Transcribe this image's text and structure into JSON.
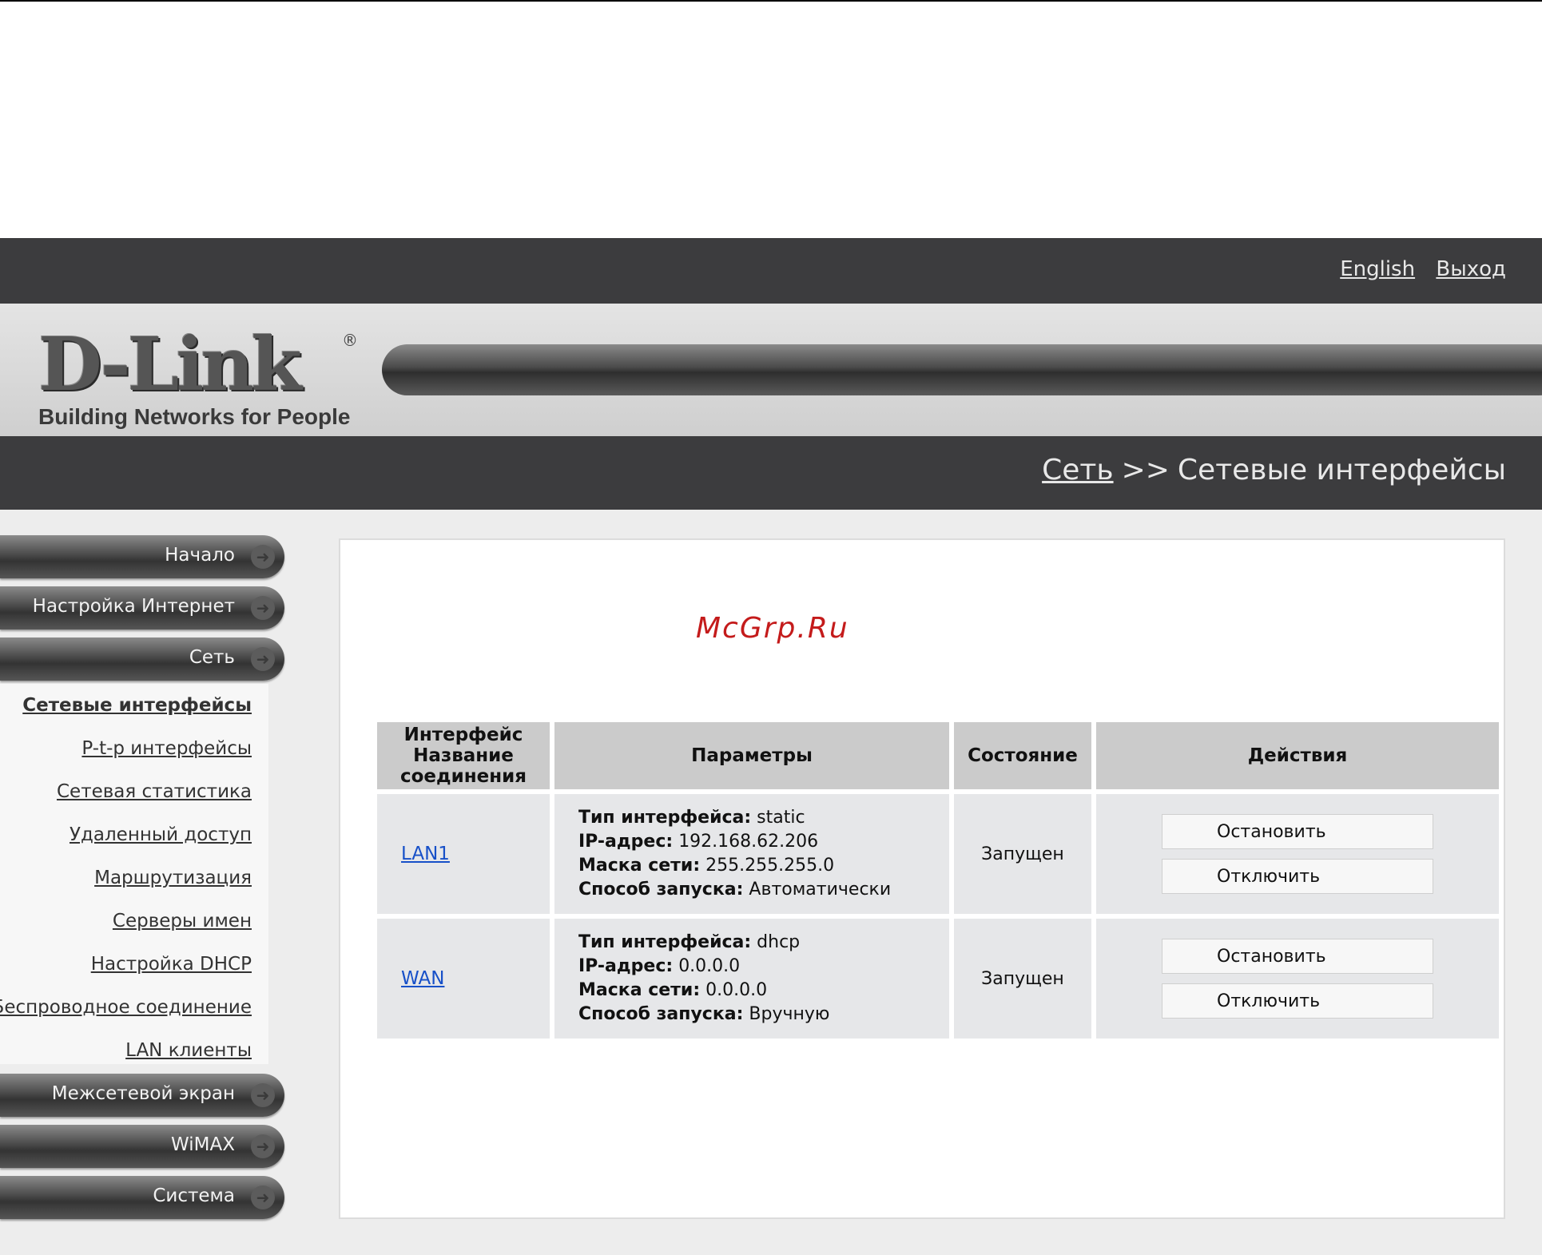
{
  "header": {
    "links": [
      "English",
      "Выход"
    ]
  },
  "logo": {
    "wordmark": "D-Link",
    "registered": "®",
    "tagline": "Building Networks for People"
  },
  "breadcrumb": {
    "parent": "Сеть",
    "separator": ">>",
    "current": "Сетевые интерфейсы"
  },
  "sidebar": {
    "top_items": [
      "Начало",
      "Настройка Интернет",
      "Сеть"
    ],
    "submenu": [
      "Сетевые интерфейсы",
      "P-t-p интерфейсы",
      "Сетевая статистика",
      "Удаленный доступ",
      "Маршрутизация",
      "Серверы имен",
      "Настройка DHCP",
      "Беспроводное соединение",
      "LAN клиенты"
    ],
    "bottom_items": [
      "Межсетевой экран",
      "WiMAX",
      "Система"
    ],
    "arrow_icon": "arrow-right-icon"
  },
  "watermark": "McGrp.Ru",
  "table": {
    "headers": {
      "iface_line1": "Интерфейс",
      "iface_line2": "Название",
      "iface_line3": "соединения",
      "params": "Параметры",
      "state": "Состояние",
      "actions": "Действия"
    },
    "labels": {
      "type": "Тип интерфейса:",
      "ip": "IP-адрес:",
      "mask": "Маска сети:",
      "start": "Способ запуска:"
    },
    "rows": [
      {
        "name": "LAN1",
        "type": "static",
        "ip": "192.168.62.206",
        "mask": "255.255.255.0",
        "start": "Автоматически",
        "state": "Запущен",
        "btn_stop": "Остановить",
        "btn_disable": "Отключить"
      },
      {
        "name": "WAN",
        "type": "dhcp",
        "ip": "0.0.0.0",
        "mask": "0.0.0.0",
        "start": "Вручную",
        "state": "Запущен",
        "btn_stop": "Остановить",
        "btn_disable": "Отключить"
      }
    ]
  },
  "colors": {
    "dark_bar": "#3c3c3e",
    "link": "#1750c8",
    "watermark": "#c41b1b"
  }
}
